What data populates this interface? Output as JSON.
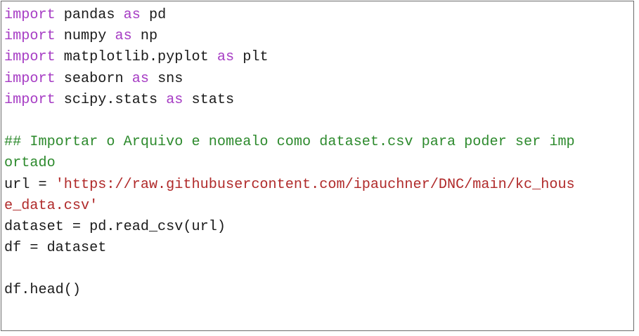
{
  "code": {
    "lines": [
      {
        "tokens": [
          {
            "t": "import",
            "k": "kw"
          },
          {
            "t": " pandas ",
            "k": "tx"
          },
          {
            "t": "as",
            "k": "kw"
          },
          {
            "t": " pd",
            "k": "tx"
          }
        ]
      },
      {
        "tokens": [
          {
            "t": "import",
            "k": "kw"
          },
          {
            "t": " numpy ",
            "k": "tx"
          },
          {
            "t": "as",
            "k": "kw"
          },
          {
            "t": " np",
            "k": "tx"
          }
        ]
      },
      {
        "tokens": [
          {
            "t": "import",
            "k": "kw"
          },
          {
            "t": " matplotlib.pyplot ",
            "k": "tx"
          },
          {
            "t": "as",
            "k": "kw"
          },
          {
            "t": " plt",
            "k": "tx"
          }
        ]
      },
      {
        "tokens": [
          {
            "t": "import",
            "k": "kw"
          },
          {
            "t": " seaborn ",
            "k": "tx"
          },
          {
            "t": "as",
            "k": "kw"
          },
          {
            "t": " sns",
            "k": "tx"
          }
        ]
      },
      {
        "tokens": [
          {
            "t": "import",
            "k": "kw"
          },
          {
            "t": " scipy.stats ",
            "k": "tx"
          },
          {
            "t": "as",
            "k": "kw"
          },
          {
            "t": " stats",
            "k": "tx"
          }
        ]
      },
      {
        "tokens": []
      },
      {
        "tokens": [
          {
            "t": "## Importar o Arquivo e nomealo como dataset.csv para poder ser imp",
            "k": "cm"
          }
        ]
      },
      {
        "tokens": [
          {
            "t": "ortado",
            "k": "cm"
          }
        ]
      },
      {
        "tokens": [
          {
            "t": "url = ",
            "k": "tx"
          },
          {
            "t": "'https://raw.githubusercontent.com/ipauchner/DNC/main/kc_hous",
            "k": "st"
          }
        ]
      },
      {
        "tokens": [
          {
            "t": "e_data.csv'",
            "k": "st"
          }
        ]
      },
      {
        "tokens": [
          {
            "t": "dataset = pd.read_csv(url)",
            "k": "tx"
          }
        ]
      },
      {
        "tokens": [
          {
            "t": "df = dataset",
            "k": "tx"
          }
        ]
      },
      {
        "tokens": []
      },
      {
        "tokens": [
          {
            "t": "df.head()",
            "k": "tx"
          }
        ]
      }
    ]
  },
  "colors": {
    "keyword": "#a63cc4",
    "comment": "#2d8a2d",
    "string": "#b02a2a",
    "text": "#1a1a1a",
    "border": "#6b6b6b"
  }
}
